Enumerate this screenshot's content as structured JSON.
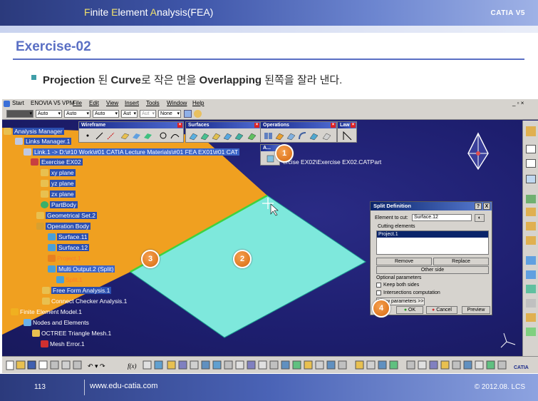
{
  "slide": {
    "header_parts": [
      {
        "text": "F",
        "hl": true
      },
      {
        "text": "inite ",
        "hl": false
      },
      {
        "text": "E",
        "hl": true
      },
      {
        "text": "lement ",
        "hl": false
      },
      {
        "text": "A",
        "hl": true
      },
      {
        "text": "nalysis(FEA)",
        "hl": false
      }
    ],
    "brand": "CATIA V5",
    "exercise_title": "Exercise-02",
    "bullet": {
      "part1": "Projection",
      "part2": " 된 ",
      "part3": "Curve",
      "part4": "로 작은 면을 ",
      "part5": "Overlapping",
      "part6": " 된쪽을 잘라 낸다."
    },
    "footer": {
      "page": "113",
      "url": "www.edu-catia.com",
      "copyright": "© 2012.08. LCS"
    }
  },
  "menubar": {
    "items": [
      "Start",
      "ENOVIA V5 VPM",
      "File",
      "Edit",
      "View",
      "Insert",
      "Tools",
      "Window",
      "Help"
    ]
  },
  "propbar": {
    "combos": [
      "Auto",
      "Auto",
      "Auto",
      "Aut",
      "Aut",
      "None"
    ]
  },
  "tree": {
    "items": [
      "Analysis Manager",
      "Links Manager.1",
      "Link.1 -> D:\\#10 Work\\#01 CATIA Lecture Materials\\#01 FEA EX01\\#01 CAT",
      "Exercise EX02",
      "xy plane",
      "yz plane",
      "zx plane",
      "PartBody",
      "Geometrical Set.2",
      "Operation Body",
      "Surface.11",
      "Surface.12",
      "Project.1",
      "Multi Output.2 (Split)",
      "Split.1",
      "Free Form Analysis.1",
      "Connect Checker Analysis.1",
      "Finite Element Model.1",
      "Nodes and Elements",
      "OCTREE Triangle Mesh.1",
      "Mesh Error.1"
    ],
    "path_tail": "ercise EX02\\Exercise EX02.CATPart"
  },
  "toolbars": {
    "wireframe": "Wireframe",
    "surfaces": "Surfaces",
    "operations": "Operations",
    "law": "Law",
    "small": "A..."
  },
  "dialog": {
    "title": "Split Definition",
    "help": "?",
    "close": "X",
    "element_label": "Element to cut:",
    "element_value": "Surface.12",
    "cutting_label": "Cutting elements",
    "cutting_items": [
      "Project.1"
    ],
    "remove": "Remove",
    "replace": "Replace",
    "other_side": "Other side",
    "optional": "Optional parameters",
    "keep_both": "Keep both sides",
    "intersections": "Intersections computation",
    "show_params": "Show parameters >>",
    "ok": "OK",
    "cancel": "Cancel",
    "preview": "Preview"
  },
  "markers": [
    "1",
    "2",
    "3",
    "4"
  ],
  "colors": {
    "canvas_bg": "#1d1e6e",
    "orange_surface": "#f0a020",
    "cyan_surface": "#7ee8dc",
    "marker": "#e07a22",
    "header": "#3e55a8"
  }
}
